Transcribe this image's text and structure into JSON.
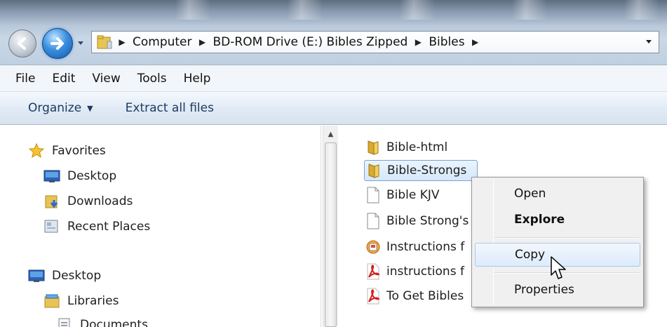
{
  "address_bar": {
    "breadcrumbs": [
      "Computer",
      "BD-ROM Drive (E:) Bibles Zipped",
      "Bibles"
    ]
  },
  "menu": [
    "File",
    "Edit",
    "View",
    "Tools",
    "Help"
  ],
  "commands": {
    "organize": "Organize",
    "extract": "Extract all files"
  },
  "nav_pane": {
    "favorites": "Favorites",
    "desktop": "Desktop",
    "downloads": "Downloads",
    "recent_places": "Recent Places",
    "desktop_root": "Desktop",
    "libraries": "Libraries",
    "documents": "Documents"
  },
  "files": [
    {
      "name": "Bible-html",
      "icon": "folder-icon"
    },
    {
      "name": "Bible-Strongs",
      "icon": "folder-icon"
    },
    {
      "name": "Bible KJV",
      "icon": "document-icon"
    },
    {
      "name": "Bible Strong's",
      "icon": "document-icon"
    },
    {
      "name": "Instructions f",
      "icon": "html-file-icon"
    },
    {
      "name": "instructions f",
      "icon": "pdf-icon"
    },
    {
      "name": "To Get Bibles",
      "icon": "pdf-icon"
    }
  ],
  "context_menu": {
    "open": "Open",
    "explore": "Explore",
    "copy": "Copy",
    "properties": "Properties"
  },
  "colors": {
    "selection_border": "#7da2ce",
    "command_text": "#1c3a63",
    "menu_hover_border": "#a8c8ec"
  }
}
